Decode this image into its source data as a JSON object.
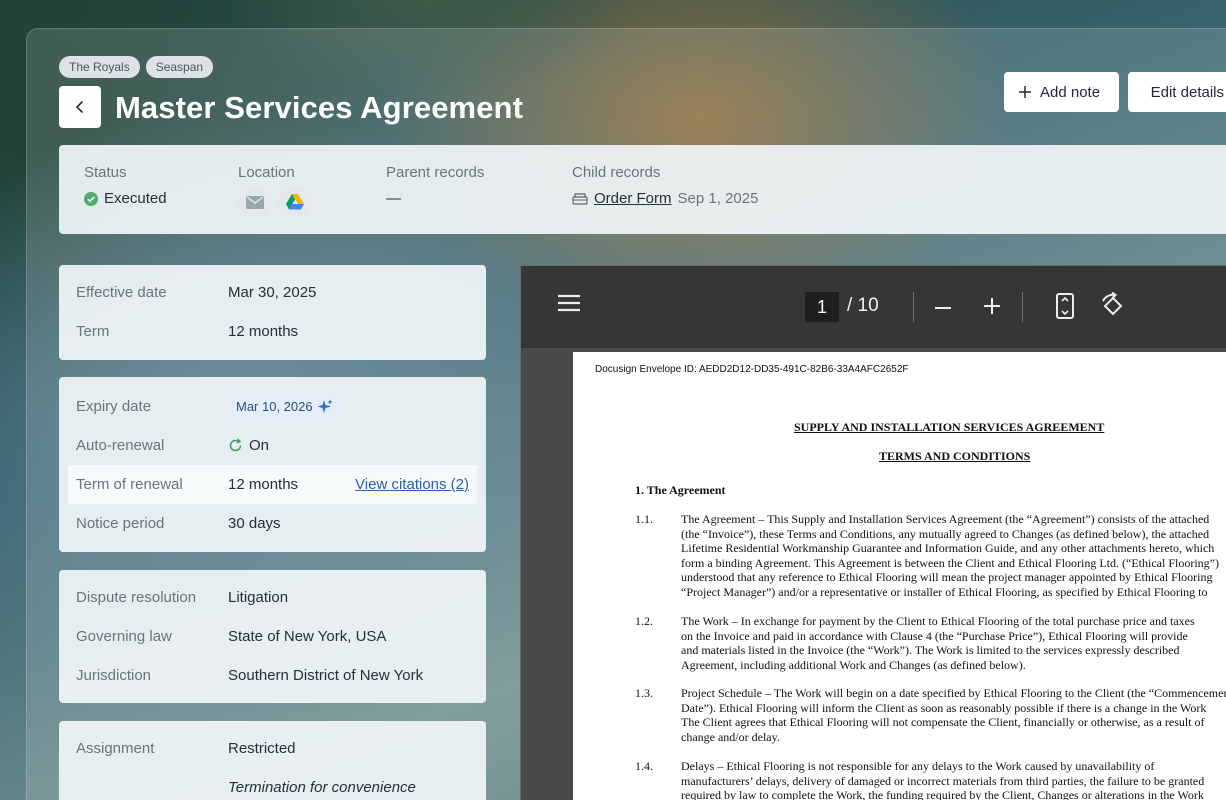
{
  "breadcrumb": [
    "The Royals",
    "Seaspan"
  ],
  "header": {
    "title": "Master Services Agreement",
    "add_note_label": "Add note",
    "edit_label": "Edit details"
  },
  "info": {
    "status_label": "Status",
    "status_value": "Executed",
    "location_label": "Location",
    "location_icons": [
      "mail-icon",
      "google-drive-icon"
    ],
    "parent_label": "Parent records",
    "parent_value": "—",
    "child_label": "Child records",
    "child_link": "Order Form",
    "child_date": "Sep 1, 2025"
  },
  "cards": {
    "dates": [
      {
        "label": "Effective date",
        "value": "Mar 30, 2025"
      },
      {
        "label": "Term",
        "value": "12 months"
      }
    ],
    "renewal": {
      "expiry_label": "Expiry date",
      "expiry_value": "Mar 10, 2026",
      "auto_label": "Auto-renewal",
      "auto_value": "On",
      "term_renewal_label": "Term of renewal",
      "term_renewal_value": "12 months",
      "citations_label": "View citations (2)",
      "notice_label": "Notice period",
      "notice_value": "30 days"
    },
    "legal": [
      {
        "label": "Dispute resolution",
        "value": "Litigation"
      },
      {
        "label": "Governing law",
        "value": "State of New York, USA"
      },
      {
        "label": "Jurisdiction",
        "value": "Southern District of New York"
      }
    ],
    "assignment": {
      "label": "Assignment",
      "value": "Restricted",
      "note": "Termination for convenience"
    }
  },
  "viewer": {
    "page_current": "1",
    "page_total": "/ 10",
    "envelope_id": "Docusign Envelope ID: AEDD2D12-DD35-491C-82B6-33A4AFC2652F",
    "doc_title": "SUPPLY AND INSTALLATION SERVICES AGREEMENT",
    "doc_subtitle": "TERMS AND CONDITIONS",
    "section_heading": "1.    The Agreement",
    "clauses": [
      {
        "num": "1.1.",
        "lines": [
          "The Agreement – This Supply and Installation Services Agreement (the “Agreement”) consists of the attached",
          "(the “Invoice”), these Terms and Conditions, any mutually agreed to Changes (as defined below), the attached",
          "Lifetime Residential Workmanship Guarantee and Information Guide, and any other attachments hereto, which",
          "form a binding Agreement. This Agreement is between the Client and Ethical Flooring Ltd. (“Ethical Flooring”)",
          "understood that any reference to Ethical Flooring will mean the project manager appointed by Ethical Flooring",
          "“Project Manager”) and/or a representative or installer of Ethical Flooring, as specified by Ethical Flooring to"
        ]
      },
      {
        "num": "1.2.",
        "lines": [
          "The Work – In exchange for payment by the Client to Ethical Flooring of the total purchase price and taxes",
          "on the Invoice and paid in accordance with Clause 4 (the “Purchase Price”), Ethical Flooring will provide",
          "and materials listed in the Invoice (the “Work”). The Work is limited to the services expressly described",
          "Agreement, including additional Work and Changes (as defined below)."
        ]
      },
      {
        "num": "1.3.",
        "lines": [
          "Project Schedule – The Work will begin on a date specified by Ethical Flooring to the Client (the “Commencement",
          "Date”). Ethical Flooring will inform the Client as soon as reasonably possible if there is a change in the Work",
          "The Client agrees that Ethical Flooring will not compensate the Client, financially or otherwise, as a result of",
          "change and/or delay."
        ]
      },
      {
        "num": "1.4.",
        "lines": [
          "Delays – Ethical Flooring is not responsible for any delays to the Work caused by unavailability of",
          "manufacturers’ delays, delivery of damaged or incorrect materials from third parties, the failure to be granted",
          "required by law to complete the Work, the funding required by the Client, Changes or alterations in the Work"
        ]
      }
    ]
  }
}
